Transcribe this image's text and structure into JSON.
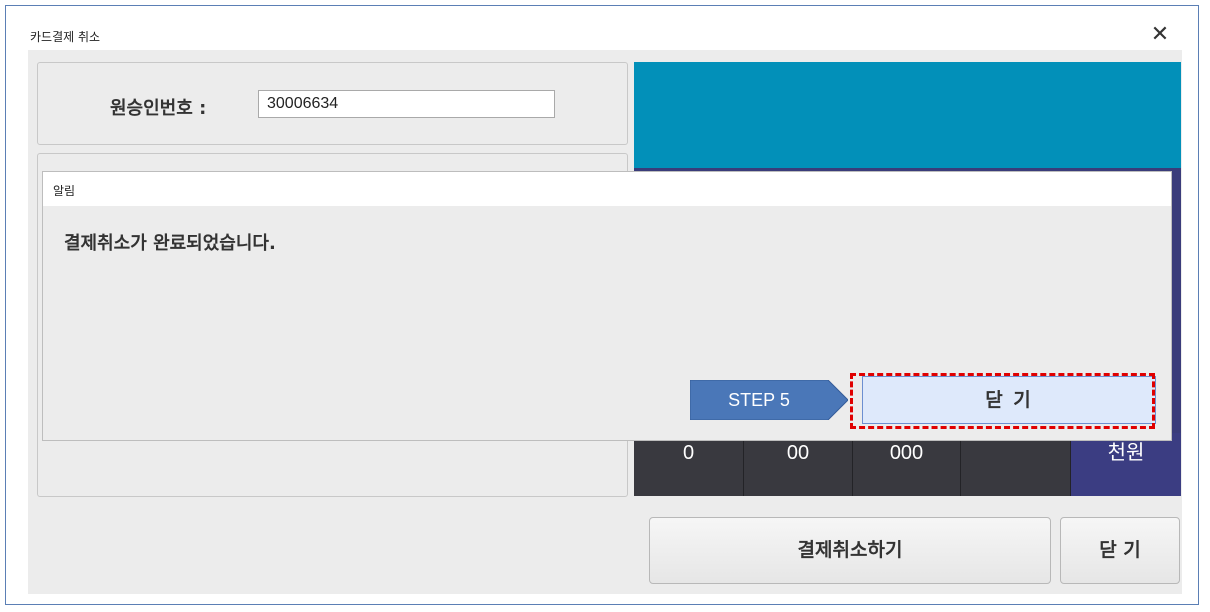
{
  "window": {
    "title": "카드결제 취소",
    "close_glyph": "✕"
  },
  "approval": {
    "label": "원승인번호 :",
    "value": "30006634"
  },
  "keypad": {
    "keys": [
      "0",
      "00",
      "000",
      "",
      "천원"
    ]
  },
  "buttons": {
    "cancel_payment": "결제취소하기",
    "close": "닫 기"
  },
  "dialog": {
    "title": "알림",
    "message": "결제취소가 완료되었습니다.",
    "close_button": "닫 기"
  },
  "annotation": {
    "step_label": "STEP 5",
    "highlight_color": "#e00000",
    "step_color": "#4a77b8"
  },
  "colors": {
    "teal": "#0290b9",
    "navy": "#3a3c7a",
    "key_dark": "#39393f"
  }
}
